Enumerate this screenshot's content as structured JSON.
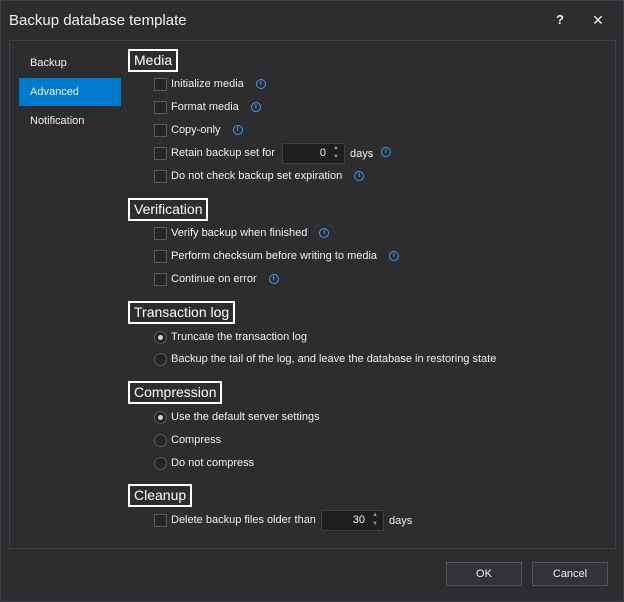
{
  "window": {
    "title": "Backup database template",
    "help_label": "?",
    "close_label": "✕"
  },
  "nav": {
    "items": [
      {
        "label": "Backup",
        "active": false
      },
      {
        "label": "Advanced",
        "active": true
      },
      {
        "label": "Notification",
        "active": false
      }
    ]
  },
  "media": {
    "title": "Media",
    "initialize": "Initialize media",
    "format": "Format media",
    "copy_only": "Copy-only",
    "retain": "Retain backup set for",
    "retain_value": "0",
    "retain_unit": "days",
    "no_check": "Do not check backup set expiration"
  },
  "verification": {
    "title": "Verification",
    "verify": "Verify backup when finished",
    "checksum": "Perform checksum before writing to media",
    "continue": "Continue on error"
  },
  "transaction_log": {
    "title": "Transaction log",
    "truncate": "Truncate the transaction log",
    "tail": "Backup the tail of the log, and leave the database in restoring state"
  },
  "compression": {
    "title": "Compression",
    "default": "Use the default server settings",
    "compress": "Compress",
    "no_compress": "Do not compress"
  },
  "cleanup": {
    "title": "Cleanup",
    "delete": "Delete backup files older than",
    "delete_value": "30",
    "delete_unit": "days"
  },
  "buttons": {
    "ok": "OK",
    "cancel": "Cancel"
  },
  "icons": {
    "info": "i",
    "spin_up": "▲",
    "spin_down": "▼"
  }
}
